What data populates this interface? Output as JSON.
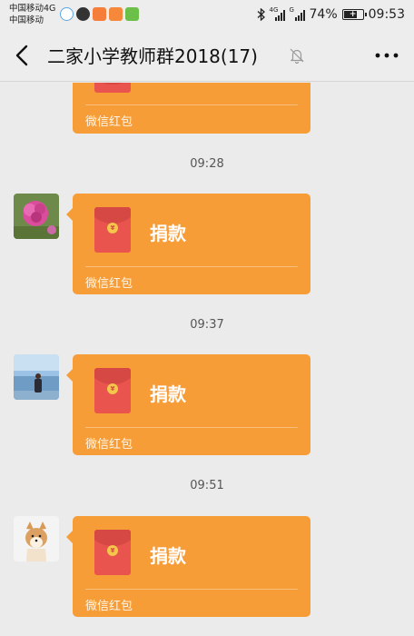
{
  "status_bar": {
    "carrier_1": "中国移动4G",
    "carrier_2": "中国移动",
    "signal_1_type": "4G",
    "signal_2_type": "G",
    "battery": "74%",
    "battery_level": 0.74,
    "time": "09:53"
  },
  "nav": {
    "title": "二家小学教师群2018(17)"
  },
  "messages": [
    {
      "footer": "微信红包"
    },
    {
      "time": "09:28",
      "label": "捐款",
      "footer": "微信红包"
    },
    {
      "time": "09:37",
      "label": "捐款",
      "footer": "微信红包"
    },
    {
      "time": "09:51",
      "label": "捐款",
      "footer": "微信红包"
    }
  ],
  "colors": {
    "bubble": "#f79d38",
    "envelope": "#e9544f",
    "background": "#ebebeb"
  }
}
